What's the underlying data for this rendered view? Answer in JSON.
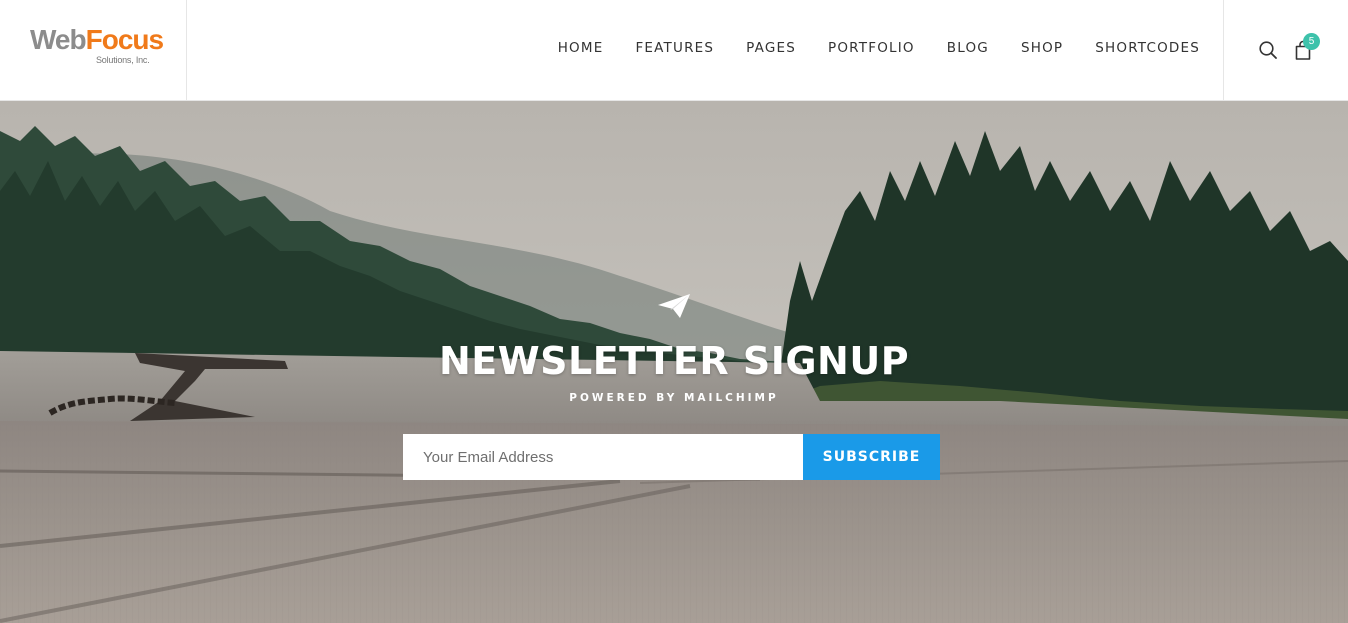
{
  "brand": {
    "name_part1": "Web",
    "name_part2": "Focus",
    "tagline": "Solutions, Inc.",
    "color_part1": "#8c8c8c",
    "color_part2": "#f07a1a"
  },
  "nav": {
    "items": [
      {
        "label": "HOME"
      },
      {
        "label": "FEATURES"
      },
      {
        "label": "PAGES"
      },
      {
        "label": "PORTFOLIO"
      },
      {
        "label": "BLOG"
      },
      {
        "label": "SHOP"
      },
      {
        "label": "SHORTCODES"
      }
    ]
  },
  "tools": {
    "search_icon": "search-icon",
    "cart_icon": "shopping-bag-icon",
    "cart_count": "5",
    "badge_color": "#3dc2ab"
  },
  "newsletter": {
    "icon": "paper-plane-icon",
    "title": "NEWSLETTER SIGNUP",
    "subtitle": "POWERED BY MAILCHIMP",
    "email_value": "",
    "email_placeholder": "Your Email Address",
    "subscribe_label": "SUBSCRIBE",
    "button_color": "#1a9ae8"
  }
}
